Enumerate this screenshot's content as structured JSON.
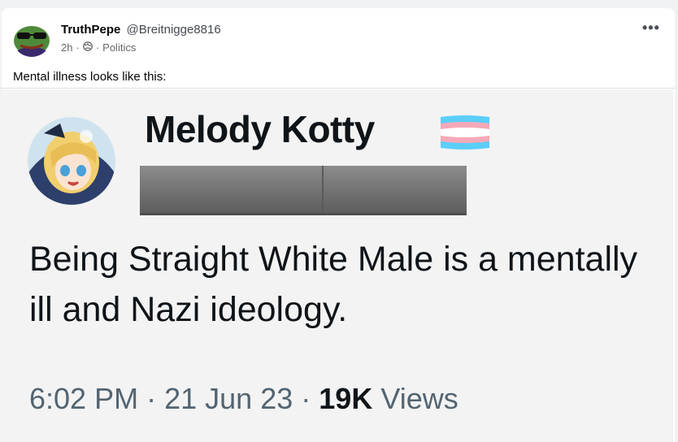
{
  "post": {
    "author_name": "TruthPepe",
    "author_handle": "@Breitnigge8816",
    "time": "2h",
    "separator": "·",
    "privacy_icon": "globe-icon",
    "category": "Politics",
    "more_label": "•••",
    "text": "Mental illness looks like this:"
  },
  "embedded_tweet": {
    "display_name": "Melody Kotty",
    "flag_icon": "transgender-flag-icon",
    "handle_redacted": true,
    "body": "Being Straight White Male is a mentally ill and Nazi ideology.",
    "time": "6:02 PM",
    "separator": "·",
    "date": "21 Jun 23",
    "views_count": "19K",
    "views_label": "Views"
  },
  "colors": {
    "flag_blue": "#5bcefa",
    "flag_pink": "#f5a9b8",
    "flag_white": "#ffffff",
    "pepe_green": "#4f8a3a",
    "redaction_gray": "#7a7a7a"
  }
}
